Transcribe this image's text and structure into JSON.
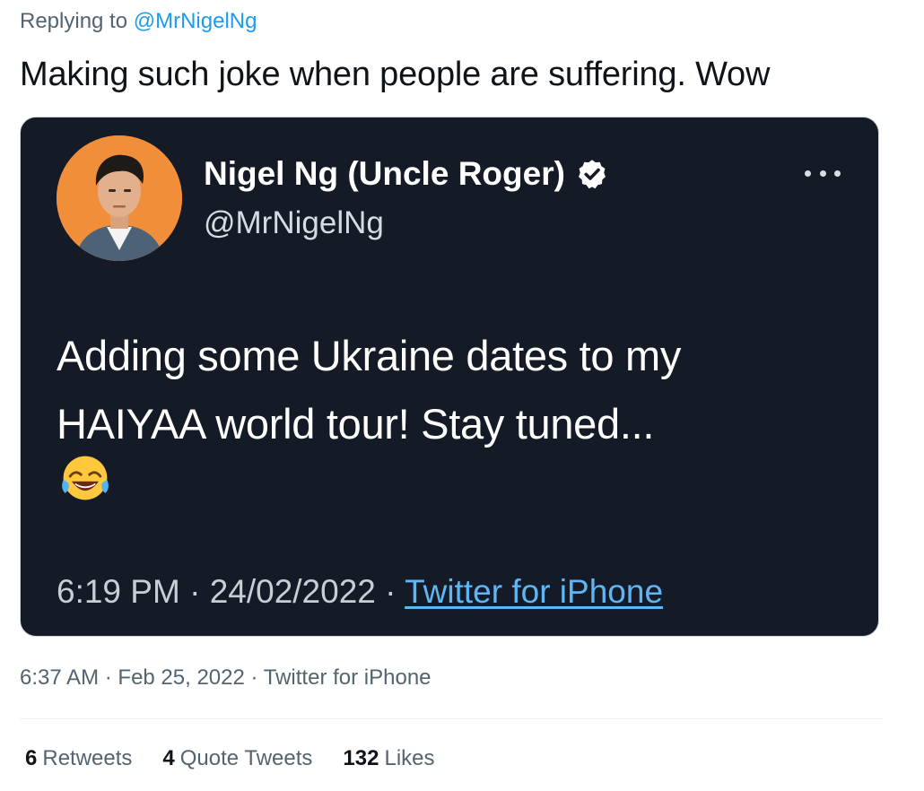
{
  "reply": {
    "replying_prefix": "Replying to",
    "replying_handle": "@MrNigelNg",
    "text": "Making such joke when people are suffering. Wow"
  },
  "quoted": {
    "name": "Nigel Ng (Uncle Roger)",
    "handle": "@MrNigelNg",
    "body_line1": "Adding some Ukraine dates to my",
    "body_line2": "HAIYAA world tour! Stay tuned...",
    "emoji": "face-with-tears-of-joy",
    "time": "6:19 PM",
    "date": "24/02/2022",
    "source": "Twitter for iPhone",
    "sep": "·",
    "verified_icon": "verified-badge-icon",
    "colors": {
      "card_bg": "#141b26",
      "link": "#5fb6f5",
      "avatar_bg": "#f08e3a"
    }
  },
  "tweet": {
    "time": "6:37 AM",
    "date": "Feb 25, 2022",
    "source": "Twitter for iPhone",
    "sep": "·"
  },
  "stats": [
    {
      "count": "6",
      "label": "Retweets"
    },
    {
      "count": "4",
      "label": "Quote Tweets"
    },
    {
      "count": "132",
      "label": "Likes"
    }
  ],
  "colors": {
    "link_blue": "#1d9bf0",
    "muted": "#536471",
    "text": "#0f1419"
  }
}
